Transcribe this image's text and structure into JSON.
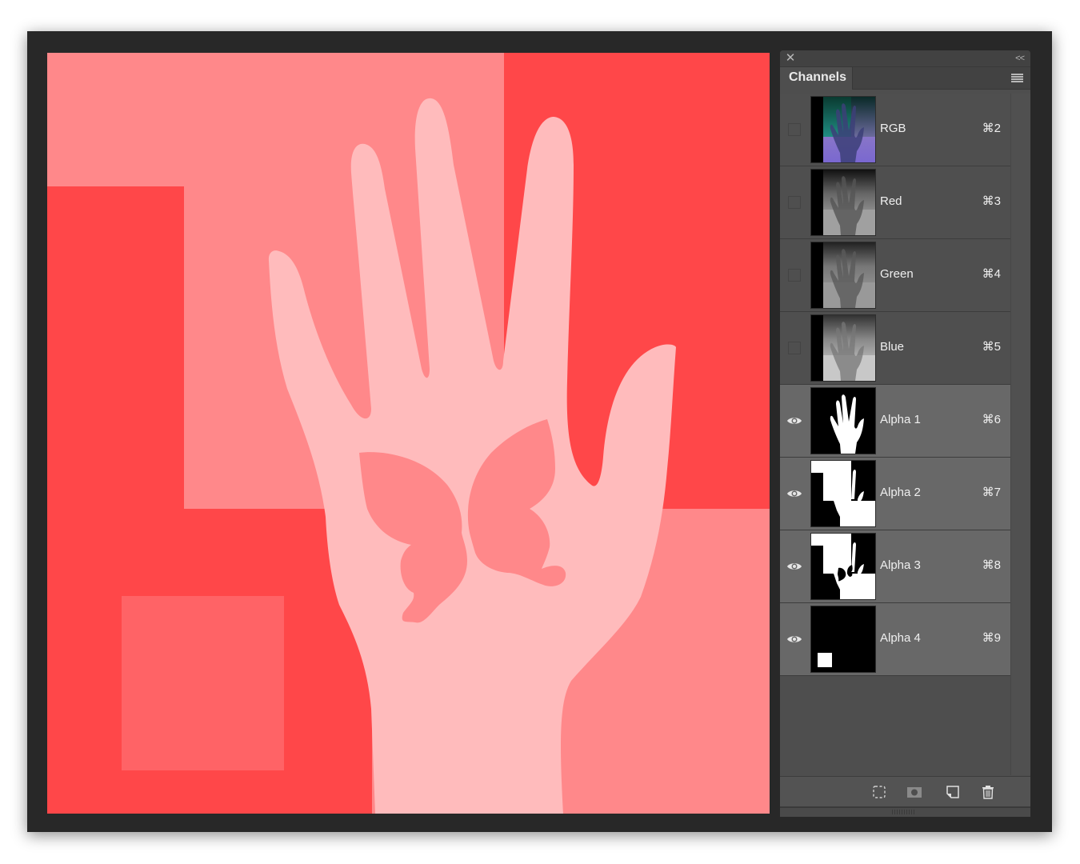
{
  "panel": {
    "title": "Channels",
    "close_icon": "close-icon",
    "collapse_icon": "double-chevron-left-icon",
    "collapse_label": "<<",
    "menu_icon": "hamburger-menu-icon"
  },
  "channels": [
    {
      "name": "RGB",
      "shortcut": "⌘2",
      "visible": false,
      "thumbnail": "composite-hand-color"
    },
    {
      "name": "Red",
      "shortcut": "⌘3",
      "visible": false,
      "thumbnail": "grayscale-hand-red"
    },
    {
      "name": "Green",
      "shortcut": "⌘4",
      "visible": false,
      "thumbnail": "grayscale-hand-green"
    },
    {
      "name": "Blue",
      "shortcut": "⌘5",
      "visible": false,
      "thumbnail": "grayscale-hand-blue"
    },
    {
      "name": "Alpha 1",
      "shortcut": "⌘6",
      "visible": true,
      "thumbnail": "mask-hand"
    },
    {
      "name": "Alpha 2",
      "shortcut": "⌘7",
      "visible": true,
      "thumbnail": "mask-steps-hand"
    },
    {
      "name": "Alpha 3",
      "shortcut": "⌘8",
      "visible": true,
      "thumbnail": "mask-steps-butterfly"
    },
    {
      "name": "Alpha 4",
      "shortcut": "⌘9",
      "visible": true,
      "thumbnail": "mask-small-square"
    }
  ],
  "footer": {
    "buttons": [
      {
        "icon": "load-selection-icon",
        "label": "Load channel as selection"
      },
      {
        "icon": "save-selection-icon",
        "label": "Save selection as channel"
      },
      {
        "icon": "new-channel-icon",
        "label": "Create new channel"
      },
      {
        "icon": "trash-icon",
        "label": "Delete current channel"
      }
    ]
  },
  "canvas": {
    "colors": {
      "light_red": "#ff888a",
      "red": "#ff4749",
      "square": "#ff6366",
      "hand": "#ffbbbc",
      "butterfly": "#ff888a"
    }
  }
}
